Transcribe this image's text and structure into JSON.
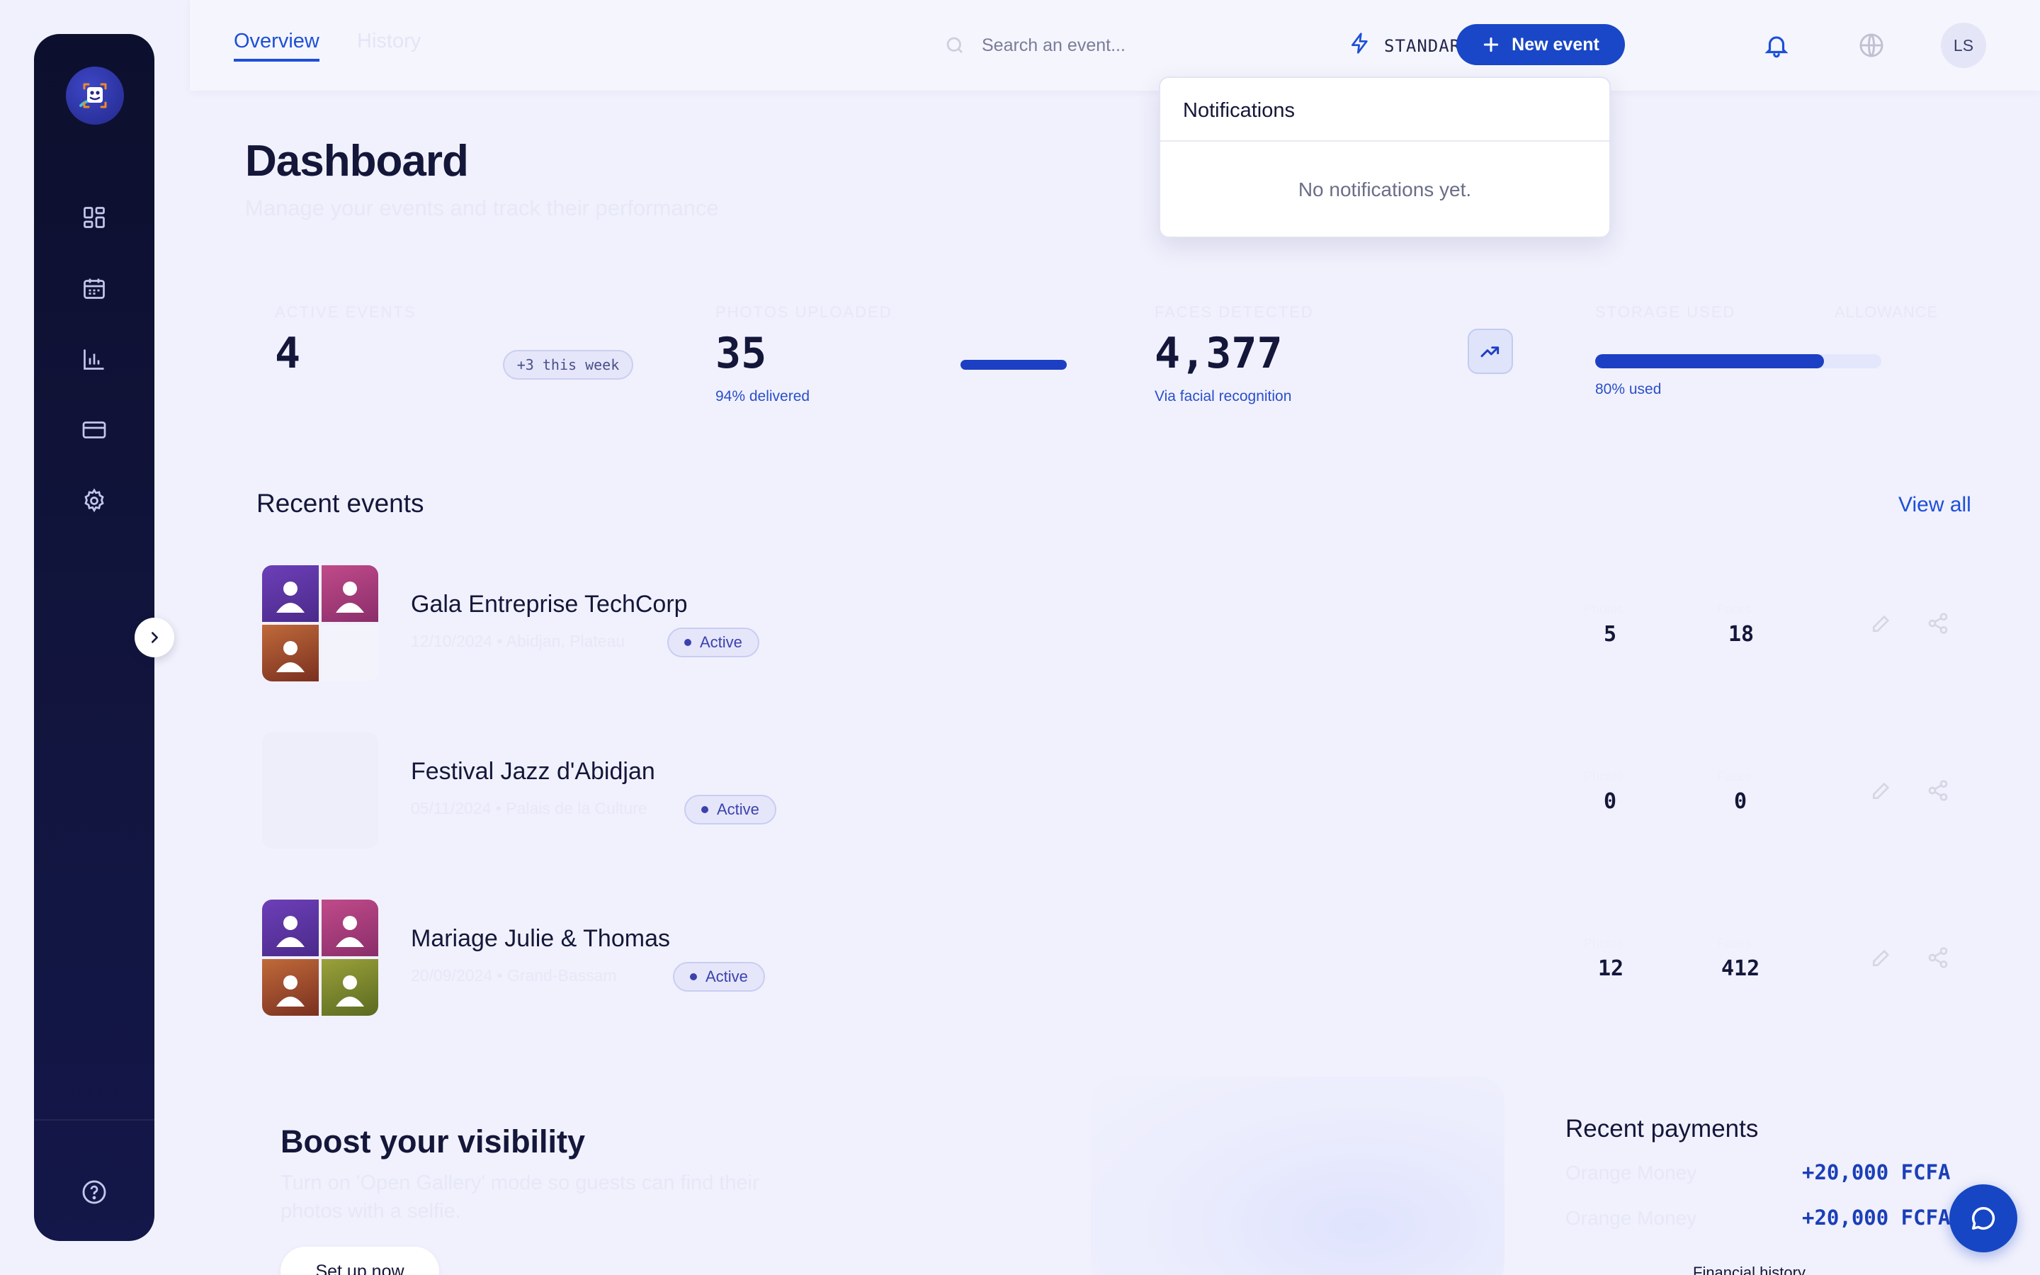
{
  "topbar": {
    "tabs": [
      {
        "label": "Overview",
        "active": true
      },
      {
        "label": "History",
        "active": false
      }
    ],
    "search_placeholder": "Search an event...",
    "plan_label": "STANDARD PLAN",
    "new_event_label": "New event",
    "avatar_initials": "LS"
  },
  "notifications": {
    "title": "Notifications",
    "empty_text": "No notifications yet."
  },
  "page": {
    "title": "Dashboard",
    "subtitle": "Manage your events and track their performance"
  },
  "stats": [
    {
      "label": "ACTIVE EVENTS",
      "value": "4",
      "chip": "+3 this week"
    },
    {
      "label": "PHOTOS UPLOADED",
      "value": "35",
      "sub": "94% delivered"
    },
    {
      "label": "FACES DETECTED",
      "value": "4,377",
      "sub": "Via facial recognition"
    },
    {
      "label": "STORAGE USED",
      "side_label": "ALLOWANCE",
      "sub": "80% used",
      "progress": 0.8
    }
  ],
  "recent_events": {
    "title": "Recent events",
    "view_all": "View all",
    "items": [
      {
        "name": "Gala Entreprise TechCorp",
        "meta": "12/10/2024 • Abidjan, Plateau",
        "status": "Active",
        "photos_label": "Photos",
        "photos": "5",
        "faces_label": "Faces",
        "faces": "18"
      },
      {
        "name": "Festival Jazz d'Abidjan",
        "meta": "05/11/2024 • Palais de la Culture",
        "status": "Active",
        "photos_label": "Photos",
        "photos": "0",
        "faces_label": "Faces",
        "faces": "0"
      },
      {
        "name": "Mariage Julie & Thomas",
        "meta": "20/09/2024 • Grand-Bassam",
        "status": "Active",
        "photos_label": "Photos",
        "photos": "12",
        "faces_label": "Faces",
        "faces": "412"
      }
    ]
  },
  "boost": {
    "title": "Boost your visibility",
    "description": "Turn on 'Open Gallery' mode so guests can find their photos with a selfie.",
    "cta": "Set up now"
  },
  "payments": {
    "title": "Recent payments",
    "items": [
      {
        "method": "Orange Money",
        "amount": "+20,000 FCFA"
      },
      {
        "method": "Orange Money",
        "amount": "+20,000 FCFA"
      }
    ],
    "history_link": "Financial history"
  },
  "colors": {
    "accent": "#1d4fd8",
    "primary_button": "#1a47c7",
    "sidebar": "#0d0f2e",
    "background": "#f1f1fd"
  },
  "icons": {
    "sidebar": [
      "dashboard-icon",
      "calendar-icon",
      "bar-chart-icon",
      "credit-card-icon",
      "settings-icon",
      "help-icon"
    ],
    "topbar": [
      "search-icon",
      "lightning-icon",
      "bell-icon",
      "plus-icon",
      "globe-icon"
    ]
  }
}
